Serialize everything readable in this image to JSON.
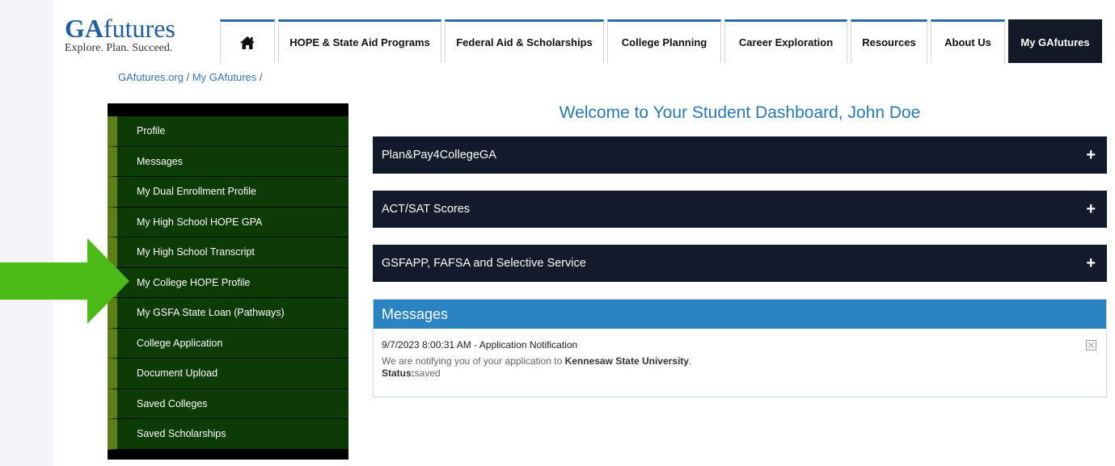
{
  "logo": {
    "brand_bold": "GA",
    "brand_rest": "futures",
    "tagline": "Explore. Plan. Succeed."
  },
  "nav": {
    "home_icon": "home-icon",
    "items": [
      "HOPE & State Aid Programs",
      "Federal Aid & Scholarships",
      "College Planning",
      "Career Exploration",
      "Resources",
      "About Us",
      "My GAfutures"
    ]
  },
  "breadcrumb": {
    "home": "GAfutures.org",
    "sep": "/",
    "current": "My GAfutures"
  },
  "sidebar": {
    "items": [
      "Profile",
      "Messages",
      "My Dual Enrollment Profile",
      "My High School HOPE GPA",
      "My High School Transcript",
      "My College HOPE Profile",
      "My GSFA State Loan (Pathways)",
      "College Application",
      "Document Upload",
      "Saved Colleges",
      "Saved Scholarships"
    ]
  },
  "main": {
    "welcome": "Welcome to Your Student Dashboard, John Doe",
    "panels": [
      "Plan&Pay4CollegeGA",
      "ACT/SAT Scores",
      "GSFAPP, FAFSA and Selective Service"
    ],
    "plus": "+"
  },
  "messages": {
    "header": "Messages",
    "item": {
      "timestamp": "9/7/2023 8:00:31 AM",
      "dash": " - ",
      "title": "Application Notification",
      "text_prefix": "We are notifying you of your application to ",
      "school": "Kennesaw State University",
      "text_suffix": ".",
      "status_label": "Status:",
      "status_value": "saved"
    }
  },
  "colors": {
    "accent": "#2a84c1",
    "sidebar_bg": "#0d3b06",
    "panel_bg": "#121a2c",
    "arrow": "#4cbb17"
  }
}
